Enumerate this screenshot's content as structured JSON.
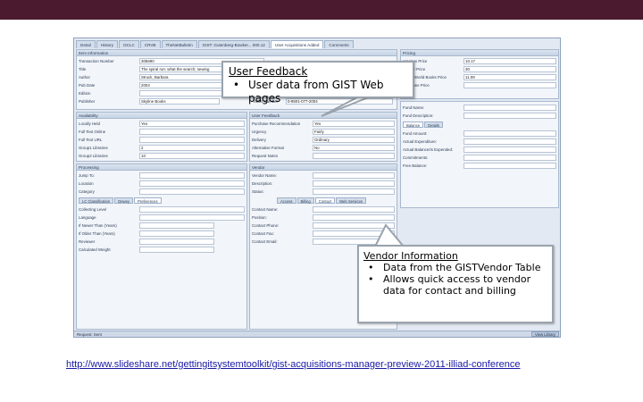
{
  "window": {
    "tabs": [
      "Detail",
      "History",
      "OCLC",
      "CRVB",
      "TheNetBulletin",
      "GIST: Gutenberg-Bowker... 000.12",
      "User Acquisitions Added",
      "Comments"
    ],
    "active_tab_index": 6
  },
  "item_info": {
    "header": "Item Information",
    "fields": [
      {
        "label": "Transaction Number",
        "value": "305690"
      },
      {
        "label": "Title",
        "value": "The spiral run: what the search; sewing"
      },
      {
        "label": "Author",
        "value": "Struck, Barbara"
      },
      {
        "label": "Pub Date",
        "value": "2004"
      },
      {
        "label": "Edition",
        "value": ""
      },
      {
        "label": "Publisher",
        "value": "Skyline Books"
      }
    ],
    "isbn_label": "ISBN Number",
    "isbn_value": "0-9501-077-2004"
  },
  "pricing": {
    "header": "Pricing",
    "fields": [
      {
        "label": "Amazon Price",
        "value": "10.17"
      },
      {
        "label": "Vendor Price",
        "value": "30"
      },
      {
        "label": "Better World Books Price",
        "value": "11.09"
      },
      {
        "label": "Purchase Price",
        "value": ""
      }
    ]
  },
  "availability": {
    "header": "Availability",
    "fields": [
      {
        "label": "Locally Held",
        "value": "Yes"
      },
      {
        "label": "Full Text Online",
        "value": ""
      },
      {
        "label": "Full Text URL",
        "value": ""
      },
      {
        "label": "Group1 Libraries",
        "value": "2"
      },
      {
        "label": "Group2 Libraries",
        "value": "10"
      }
    ]
  },
  "user_feedback": {
    "header": "User Feedback",
    "fields": [
      {
        "label": "Purchase Recommendation",
        "value": "Yes"
      },
      {
        "label": "Urgency",
        "value": "Fairly"
      },
      {
        "label": "Delivery",
        "value": "Ordinary"
      },
      {
        "label": "Alternative Format",
        "value": "No"
      },
      {
        "label": "Request Notes",
        "value": ""
      }
    ]
  },
  "funds": {
    "fields": [
      {
        "label": "Fund Name:",
        "value": ""
      },
      {
        "label": "Fund Description:",
        "value": ""
      }
    ],
    "subtabs": [
      "Balance",
      "Details"
    ],
    "balance_fields": [
      {
        "label": "Fund Amount:",
        "value": ""
      },
      {
        "label": "Actual Expenditure:",
        "value": ""
      },
      {
        "label": "Actual Balance/Is Expended:",
        "value": ""
      },
      {
        "label": "Commitments:",
        "value": ""
      },
      {
        "label": "Free Balance:",
        "value": ""
      }
    ]
  },
  "processing": {
    "header": "Processing",
    "fields": [
      {
        "label": "Jump To:",
        "value": ""
      },
      {
        "label": "Location",
        "value": ""
      },
      {
        "label": "Category",
        "value": ""
      }
    ],
    "subtabs": [
      "LC Classification",
      "Dewey",
      "Preferences"
    ],
    "pref_fields": [
      {
        "label": "Collecting Level",
        "value": ""
      },
      {
        "label": "Language",
        "value": ""
      },
      {
        "label": "If Newer Than (Years)",
        "value": ""
      },
      {
        "label": "If Older Than (Years)",
        "value": ""
      },
      {
        "label": "Reviewer",
        "value": ""
      },
      {
        "label": "Calculated Weight",
        "value": ""
      }
    ]
  },
  "vendor": {
    "header": "Vendor",
    "fields": [
      {
        "label": "Vendor Name:",
        "value": ""
      },
      {
        "label": "Description:",
        "value": ""
      },
      {
        "label": "Status:",
        "value": ""
      }
    ],
    "subtabs": [
      "Access",
      "Billing",
      "Contact",
      "Web Services"
    ],
    "contact_fields": [
      {
        "label": "Contact Name:",
        "value": ""
      },
      {
        "label": "Position:",
        "value": ""
      },
      {
        "label": "Contact Phone:",
        "value": ""
      },
      {
        "label": "Contact Fax:",
        "value": ""
      },
      {
        "label": "Contact Email:",
        "value": ""
      }
    ]
  },
  "status": {
    "text": "Request: Sent",
    "button": "View Library"
  },
  "callout_user": {
    "title": "User Feedback",
    "bullets": [
      "User data from GIST Web pages"
    ]
  },
  "callout_vendor": {
    "title": "Vendor Information",
    "bullets": [
      "Data from the GISTVendor Table",
      "Allows quick access to vendor data for contact and billing"
    ]
  },
  "footer": {
    "url": "http://www.slideshare.net/gettingitsystemtoolkit/gist-acquisitions-manager-preview-2011-illiad-conference"
  },
  "colors": {
    "top_bar": "#4b1a2e",
    "callout_arrow": "#9aa3ad",
    "link": "#1a1aa6"
  }
}
